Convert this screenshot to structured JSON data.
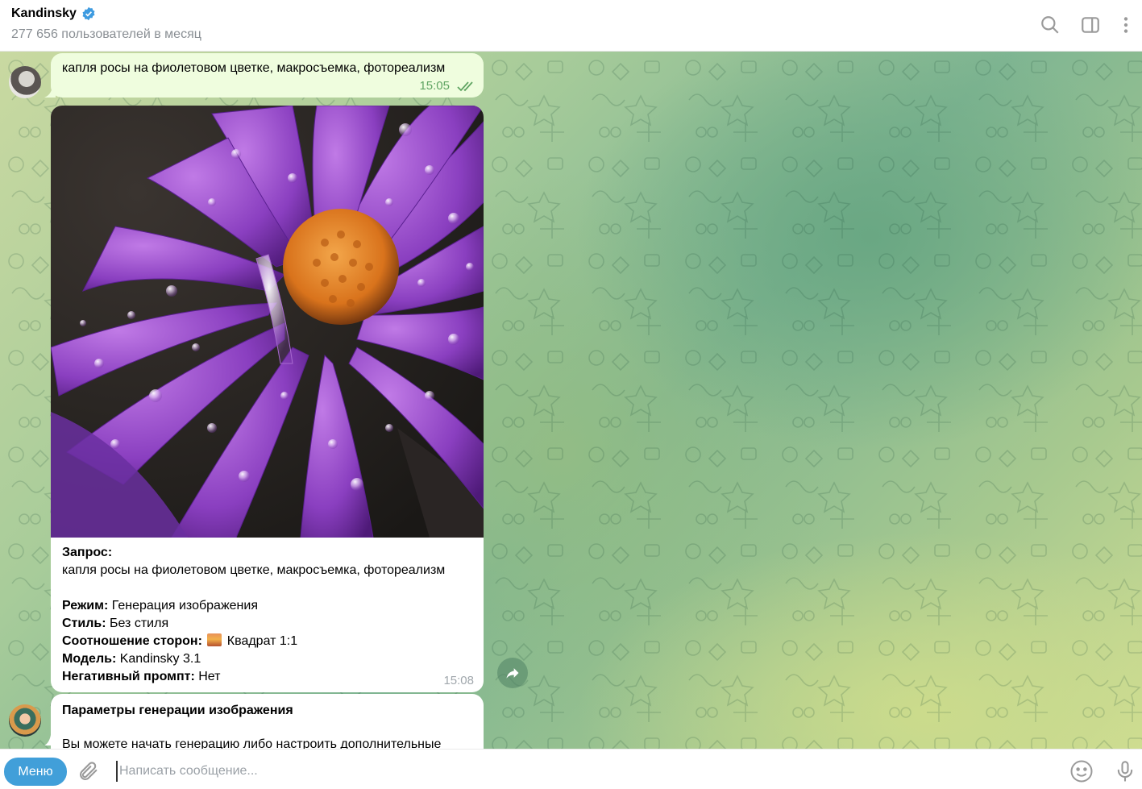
{
  "header": {
    "title": "Kandinsky",
    "subtitle": "277 656 пользователей в месяц"
  },
  "messages": {
    "outgoing": {
      "text": "капля росы на фиолетовом цветке, макросъемка, фотореализм",
      "time": "15:05"
    },
    "result": {
      "request_label": "Запрос:",
      "request_text": "капля росы на фиолетовом цветке, макросъемка, фотореализм",
      "mode_label": "Режим:",
      "mode_value": " Генерация изображения",
      "style_label": "Стиль:",
      "style_value": " Без стиля",
      "ratio_label": "Соотношение сторон:",
      "ratio_value": "Квадрат 1:1",
      "model_label": "Модель:",
      "model_value": " Kandinsky 3.1",
      "negative_label": "Негативный промпт:",
      "negative_value": " Нет",
      "time": "15:08"
    },
    "params": {
      "title": "Параметры генерации изображения",
      "body": "Вы можете начать генерацию либо настроить дополнительные"
    }
  },
  "composer": {
    "menu_label": "Меню",
    "placeholder": "Написать сообщение..."
  },
  "colors": {
    "accent": "#419fd9",
    "outgoing_bubble": "#effdde",
    "time_outgoing": "#5fa462",
    "verified": "#3e9be0"
  },
  "icons": [
    "verified-icon",
    "search-icon",
    "sidebar-toggle-icon",
    "more-vertical-icon",
    "double-check-icon",
    "share-icon",
    "paperclip-icon",
    "emoji-icon",
    "microphone-icon"
  ]
}
